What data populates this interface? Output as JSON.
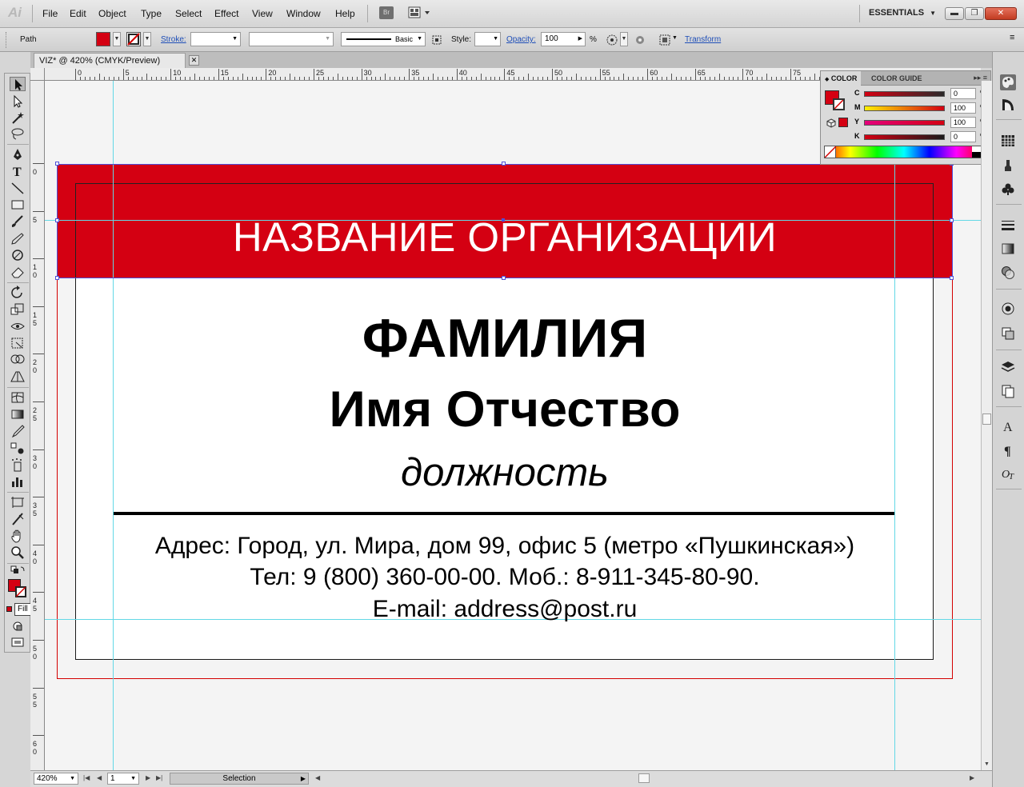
{
  "app": {
    "logo": "Ai",
    "menu": [
      "File",
      "Edit",
      "Object",
      "Type",
      "Select",
      "Effect",
      "View",
      "Window",
      "Help"
    ],
    "bridge_label": "Br",
    "workspace": "ESSENTIALS",
    "window_buttons": {
      "minimize": "▬",
      "restore": "❐",
      "close": "✕"
    }
  },
  "control_bar": {
    "selection_type": "Path",
    "fill_color": "#d40012",
    "stroke_label": "Stroke:",
    "stroke_weight": "",
    "variable_width": "",
    "brush_label": "Basic",
    "style_label": "Style:",
    "opacity_label": "Opacity:",
    "opacity_value": "100",
    "opacity_unit": "%",
    "transform_label": "Transform"
  },
  "document_tab": {
    "title": "VIZ* @ 420% (CMYK/Preview)",
    "close": "✕"
  },
  "tool_tooltip": "Fill (X)",
  "ruler_top_labels": [
    "0",
    "5",
    "10",
    "15",
    "20",
    "25",
    "30",
    "35",
    "40",
    "45",
    "50",
    "55",
    "60",
    "65",
    "70",
    "75"
  ],
  "ruler_left_labels": [
    "0",
    "5",
    "1 0",
    "1 5",
    "2 0",
    "2 5",
    "3 0",
    "3 5",
    "4 0",
    "4 5",
    "5 0",
    "5 5",
    "6 0"
  ],
  "card": {
    "organization": "НАЗВАНИЕ ОРГАНИЗАЦИИ",
    "surname": "ФАМИЛИЯ",
    "given_names": "Имя Отчество",
    "position": "должность",
    "address": "Адрес: Город, ул. Мира, дом 99, офис 5 (метро «Пушкинская»)",
    "phones": "Тел: 9 (800) 360-00-00. Моб.: 8-911-345-80-90.",
    "email": "E-mail: address@post.ru",
    "band_color": "#d40012"
  },
  "color_panel": {
    "tabs": [
      "COLOR",
      "COLOR GUIDE"
    ],
    "channels": [
      {
        "letter": "C",
        "value": "0",
        "unit": "%"
      },
      {
        "letter": "M",
        "value": "100",
        "unit": "%"
      },
      {
        "letter": "Y",
        "value": "100",
        "unit": "%"
      },
      {
        "letter": "K",
        "value": "0",
        "unit": "%"
      }
    ]
  },
  "status_bar": {
    "zoom": "420%",
    "page": "1",
    "tool_status": "Selection"
  }
}
